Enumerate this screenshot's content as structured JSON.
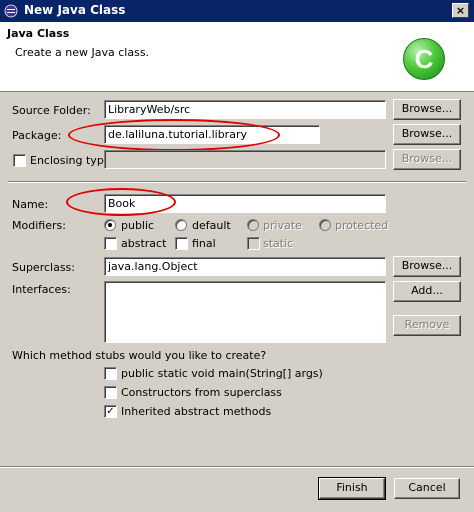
{
  "window": {
    "title": "New Java Class",
    "close_glyph": "×"
  },
  "header": {
    "title": "Java Class",
    "description": "Create a new Java class.",
    "icon_letter": "C"
  },
  "form": {
    "source_folder": {
      "label": "Source Folder:",
      "value": "LibraryWeb/src",
      "button": "Browse..."
    },
    "package": {
      "label": "Package:",
      "value": "de.laliluna.tutorial.library",
      "button": "Browse..."
    },
    "enclosing_type": {
      "label": "Enclosing type:",
      "value": "",
      "checked": false,
      "button": "Browse..."
    },
    "name": {
      "label": "Name:",
      "value": "Book"
    },
    "modifiers": {
      "label": "Modifiers:",
      "public": "public",
      "default": "default",
      "private": "private",
      "protected": "protected",
      "abstract": "abstract",
      "final": "final",
      "static": "static",
      "selected": "public"
    },
    "superclass": {
      "label": "Superclass:",
      "value": "java.lang.Object",
      "button": "Browse..."
    },
    "interfaces": {
      "label": "Interfaces:",
      "add_button": "Add...",
      "remove_button": "Remove"
    },
    "stubs": {
      "question": "Which method stubs would you like to create?",
      "main": "public static void main(String[] args)",
      "constructors": "Constructors from superclass",
      "inherited": "Inherited abstract methods",
      "checked_glyph": "✓"
    }
  },
  "footer": {
    "finish": "Finish",
    "cancel": "Cancel"
  },
  "colors": {
    "title_bar": "#0a246a",
    "dialog_bg": "#d4d0c8",
    "highlight_ellipse": "#e00000",
    "java_icon": "#4cc83c"
  }
}
